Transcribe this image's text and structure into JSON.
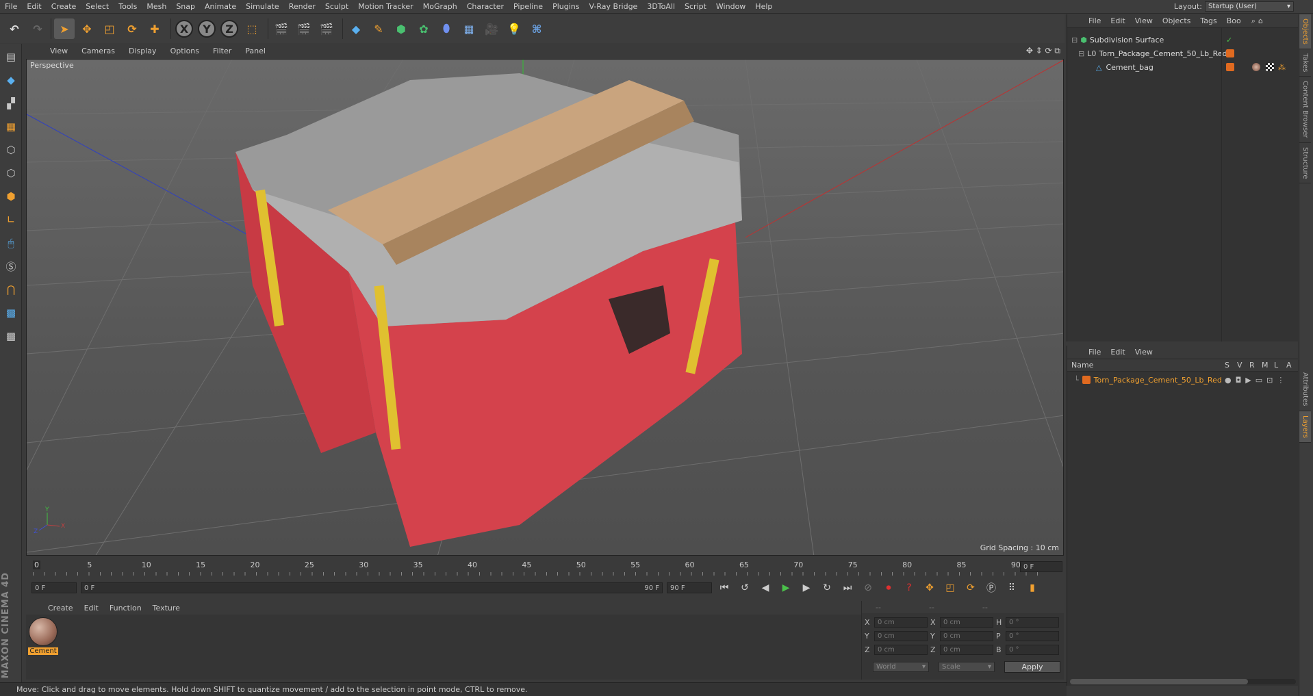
{
  "menubar": {
    "items": [
      "File",
      "Edit",
      "Create",
      "Select",
      "Tools",
      "Mesh",
      "Snap",
      "Animate",
      "Simulate",
      "Render",
      "Sculpt",
      "Motion Tracker",
      "MoGraph",
      "Character",
      "Pipeline",
      "Plugins",
      "V-Ray Bridge",
      "3DToAll",
      "Script",
      "Window",
      "Help"
    ],
    "layout_label": "Layout:",
    "layout_value": "Startup (User)"
  },
  "toolbar": {
    "axis_x": "X",
    "axis_y": "Y",
    "axis_z": "Z"
  },
  "viewport": {
    "menu": [
      "View",
      "Cameras",
      "Display",
      "Options",
      "Filter",
      "Panel"
    ],
    "label": "Perspective",
    "grid_spacing": "Grid Spacing : 10 cm"
  },
  "timeline": {
    "ticks": [
      "0",
      "5",
      "10",
      "15",
      "20",
      "25",
      "30",
      "35",
      "40",
      "45",
      "50",
      "55",
      "60",
      "65",
      "70",
      "75",
      "80",
      "85",
      "90"
    ],
    "current_frame_right": "0 F",
    "start_field": "0 F",
    "range_start": "0 F",
    "range_end": "90 F",
    "end_field": "90 F"
  },
  "material_manager": {
    "menu": [
      "Create",
      "Edit",
      "Function",
      "Texture"
    ],
    "materials": [
      {
        "name": "Cement"
      }
    ]
  },
  "coordinates": {
    "header": [
      "--",
      "--",
      "--"
    ],
    "rows": [
      {
        "l1": "X",
        "v1": "0 cm",
        "l2": "X",
        "v2": "0 cm",
        "l3": "H",
        "v3": "0 °"
      },
      {
        "l1": "Y",
        "v1": "0 cm",
        "l2": "Y",
        "v2": "0 cm",
        "l3": "P",
        "v3": "0 °"
      },
      {
        "l1": "Z",
        "v1": "0 cm",
        "l2": "Z",
        "v2": "0 cm",
        "l3": "B",
        "v3": "0 °"
      }
    ],
    "mode1": "World",
    "mode2": "Scale",
    "apply": "Apply"
  },
  "object_manager": {
    "menu": [
      "File",
      "Edit",
      "View",
      "Objects",
      "Tags",
      "Boo"
    ],
    "objects": [
      {
        "name": "Subdivision Surface"
      },
      {
        "name": "Torn_Package_Cement_50_Lb_Red"
      },
      {
        "name": "Cement_bag"
      }
    ]
  },
  "layer_manager": {
    "menu": [
      "File",
      "Edit",
      "View"
    ],
    "col_name": "Name",
    "cols": [
      "S",
      "V",
      "R",
      "M",
      "L",
      "A"
    ],
    "layers": [
      {
        "name": "Torn_Package_Cement_50_Lb_Red"
      }
    ]
  },
  "right_tabs": [
    "Objects",
    "Takes",
    "Content Browser",
    "Structure",
    "Attributes",
    "Layers"
  ],
  "statusbar": {
    "text": "Move: Click and drag to move elements. Hold down SHIFT to quantize movement / add to the selection in point mode, CTRL to remove."
  },
  "branding": "MAXON CINEMA 4D",
  "colors": {
    "accent": "#f0a030",
    "highlight_text": "#f0a030"
  }
}
